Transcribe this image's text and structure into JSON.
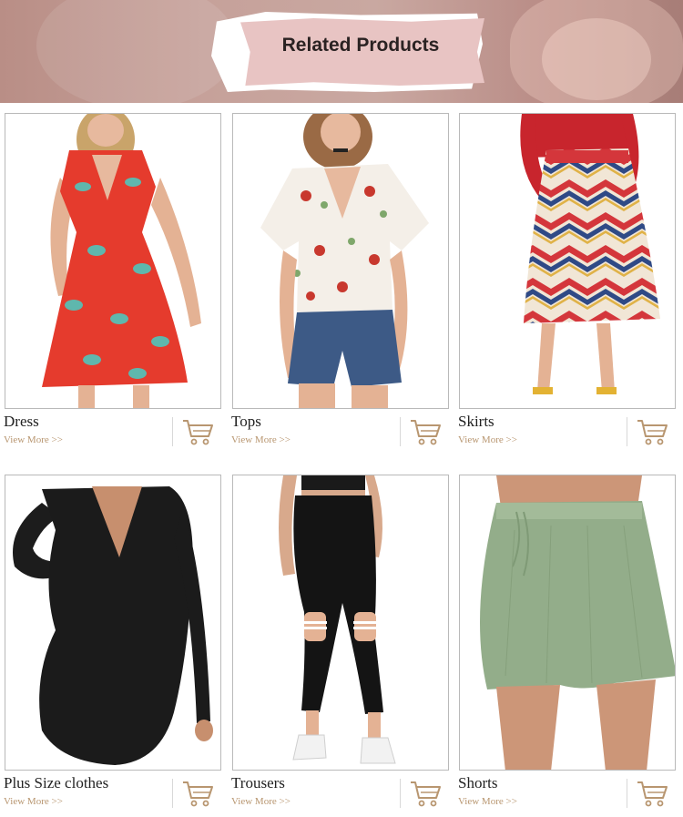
{
  "banner": {
    "title": "Related Products"
  },
  "products": [
    {
      "name": "Dress",
      "more": "View More >>"
    },
    {
      "name": "Tops",
      "more": "View More >>"
    },
    {
      "name": "Skirts",
      "more": "View More >>"
    },
    {
      "name": "Plus Size clothes",
      "more": "View More >>"
    },
    {
      "name": "Trousers",
      "more": "View More >>"
    },
    {
      "name": "Shorts",
      "more": "View More >>"
    }
  ],
  "colors": {
    "accent": "#b89670",
    "banner": "#c6a19a",
    "border": "#b9b9b9"
  },
  "icons": {
    "cart": "shopping-cart-icon"
  }
}
